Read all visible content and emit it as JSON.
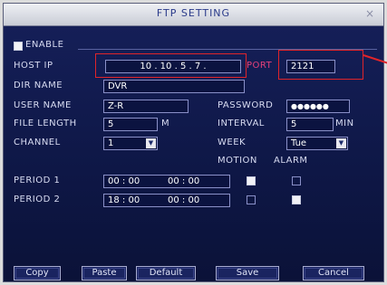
{
  "window": {
    "title": "FTP SETTING",
    "close_glyph": "×"
  },
  "enable": {
    "label": "ENABLE",
    "checked": true
  },
  "host_ip": {
    "label": "HOST IP",
    "value": "10 . 10 . 5 . 7 ."
  },
  "port": {
    "label": "PORT",
    "value": "2121"
  },
  "dir_name": {
    "label": "DIR NAME",
    "value": "DVR"
  },
  "user_name": {
    "label": "USER NAME",
    "value": "Z-R"
  },
  "password": {
    "label": "PASSWORD",
    "value": "●●●●●●"
  },
  "file_length": {
    "label": "FILE LENGTH",
    "value": "5",
    "unit": "M"
  },
  "interval": {
    "label": "INTERVAL",
    "value": "5",
    "unit": "MIN"
  },
  "channel": {
    "label": "CHANNEL",
    "value": "1"
  },
  "week": {
    "label": "WEEK",
    "value": "Tue"
  },
  "columns": {
    "motion": "MOTION",
    "alarm": "ALARM"
  },
  "periods": [
    {
      "label": "PERIOD 1",
      "start": "00 : 00",
      "end": "00 : 00",
      "motion": true,
      "alarm": false
    },
    {
      "label": "PERIOD 2",
      "start": "18 : 00",
      "end": "00 : 00",
      "motion": false,
      "alarm": true
    }
  ],
  "buttons": {
    "copy": "Copy",
    "paste": "Paste",
    "default": "Default",
    "save": "Save",
    "cancel": "Cancel"
  },
  "colors": {
    "highlight": "#e0242a",
    "panel": "#101a4a",
    "title_text": "#2a3a8a"
  },
  "icons": {
    "close": "close-icon",
    "dropdown": "chevron-down-icon"
  }
}
